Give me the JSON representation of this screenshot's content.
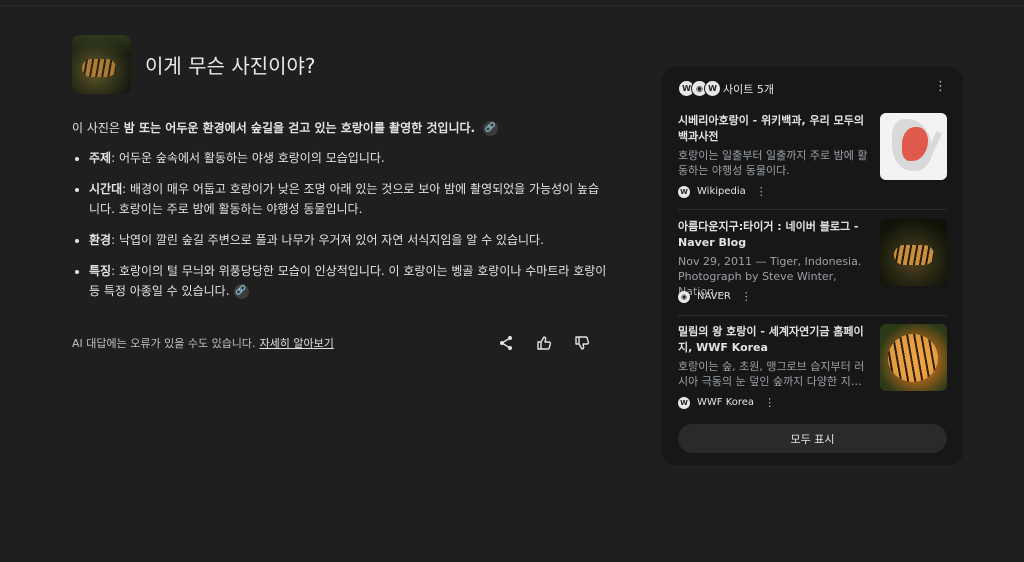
{
  "query": {
    "text": "이게 무슨 사진이야?"
  },
  "answer": {
    "intro_prefix": "이 사진은 ",
    "intro_bold": "밤 또는 어두운 환경에서 숲길을 걷고 있는 호랑이를 촬영한 것입니다.",
    "bullets": [
      {
        "label": "주제",
        "text": ": 어두운 숲속에서 활동하는 야생 호랑이의 모습입니다."
      },
      {
        "label": "시간대",
        "text": ": 배경이 매우 어둡고 호랑이가 낮은 조명 아래 있는 것으로 보아 밤에 촬영되었을 가능성이 높습니다. 호랑이는 주로 밤에 활동하는 야행성 동물입니다."
      },
      {
        "label": "환경",
        "text": ": 낙엽이 깔린 숲길 주변으로 풀과 나무가 우거져 있어 자연 서식지임을 알 수 있습니다."
      },
      {
        "label": "특징",
        "text": ": 호랑이의 털 무늬와 위풍당당한 모습이 인상적입니다. 이 호랑이는 벵골 호랑이나 수마트라 호랑이 등 특정 아종일 수 있습니다."
      }
    ]
  },
  "footer": {
    "disclaimer": "AI 대답에는 오류가 있을 수도 있습니다.",
    "learn_more": "자세히 알아보기"
  },
  "sources_panel": {
    "header": "사이트 5개",
    "header_favicons": [
      "W",
      "◉",
      "W"
    ],
    "items": [
      {
        "title": "시베리아호랑이 - 위키백과, 우리 모두의 백과사전",
        "snippet": "호랑이는 일출부터 일출까지 주로 밤에 활동하는 야행성 동물이다.",
        "site": "Wikipedia",
        "favicon": "W"
      },
      {
        "title": "아름다운지구:타이거 : 네이버 블로그 - Naver Blog",
        "snippet": "Nov 29, 2011 — Tiger, Indonesia. Photograph by Steve Winter, Nation…",
        "site": "NAVER",
        "favicon": "◉"
      },
      {
        "title": "밀림의 왕 호랑이 - 세계자연기금 홈페이지, WWF Korea",
        "snippet": "호랑이는 숲, 초원, 맹그로브 습지부터 러시아 극동의 눈 덮인 숲까지 다양한 지…",
        "site": "WWF Korea",
        "favicon": "W"
      }
    ],
    "show_all": "모두 표시"
  }
}
